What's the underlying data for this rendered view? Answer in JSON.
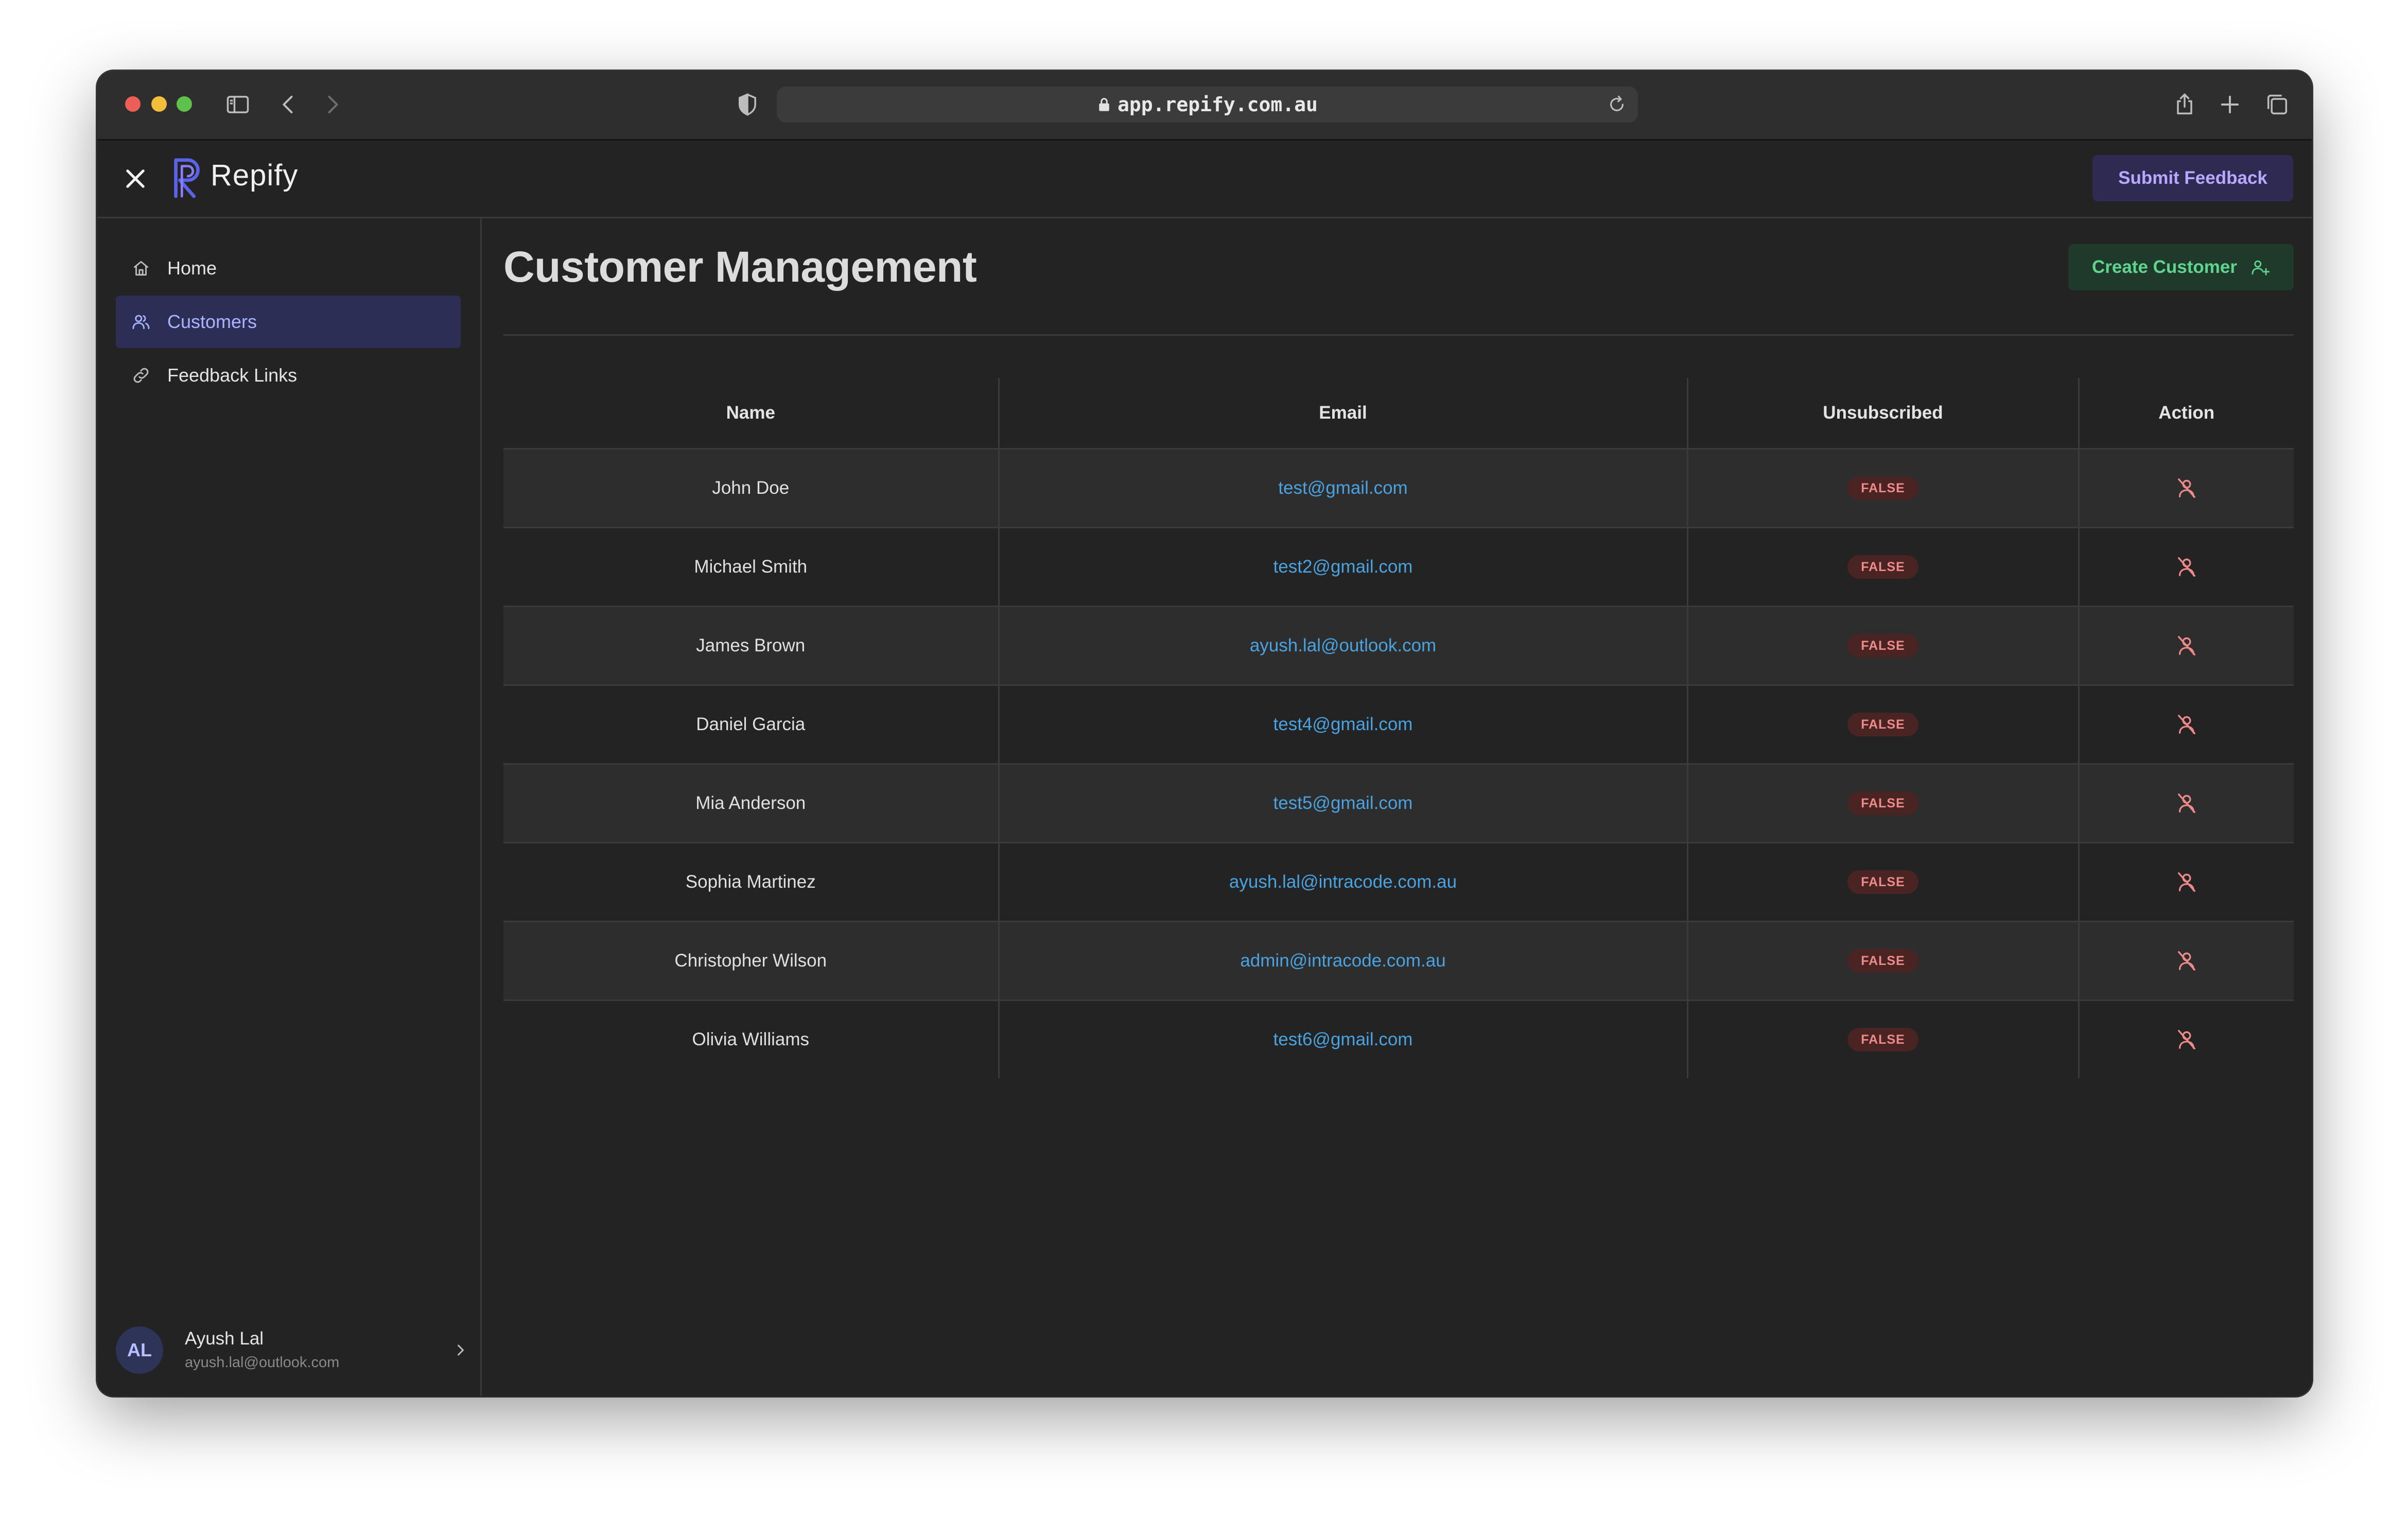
{
  "browser": {
    "url": "app.repify.com.au"
  },
  "app": {
    "logo_text": "Repify",
    "submit_feedback_label": "Submit Feedback"
  },
  "sidebar": {
    "items": [
      {
        "label": "Home",
        "icon": "home-icon"
      },
      {
        "label": "Customers",
        "icon": "users-icon",
        "active": true
      },
      {
        "label": "Feedback Links",
        "icon": "link-icon"
      }
    ],
    "user": {
      "initials": "AL",
      "name": "Ayush Lal",
      "email": "ayush.lal@outlook.com"
    }
  },
  "main": {
    "title": "Customer Management",
    "create_label": "Create Customer",
    "table": {
      "headers": [
        "Name",
        "Email",
        "Unsubscribed",
        "Action"
      ],
      "rows": [
        {
          "name": "John Doe",
          "email": "test@gmail.com",
          "unsubscribed": "FALSE"
        },
        {
          "name": "Michael Smith",
          "email": "test2@gmail.com",
          "unsubscribed": "FALSE"
        },
        {
          "name": "James Brown",
          "email": "ayush.lal@outlook.com",
          "unsubscribed": "FALSE"
        },
        {
          "name": "Daniel Garcia",
          "email": "test4@gmail.com",
          "unsubscribed": "FALSE"
        },
        {
          "name": "Mia Anderson",
          "email": "test5@gmail.com",
          "unsubscribed": "FALSE"
        },
        {
          "name": "Sophia Martinez",
          "email": "ayush.lal@intracode.com.au",
          "unsubscribed": "FALSE"
        },
        {
          "name": "Christopher Wilson",
          "email": "admin@intracode.com.au",
          "unsubscribed": "FALSE"
        },
        {
          "name": "Olivia Williams",
          "email": "test6@gmail.com",
          "unsubscribed": "FALSE"
        }
      ]
    }
  },
  "colors": {
    "accent": "#a9b4ff",
    "create_button": "#5fd48e",
    "badge_false": "#ef8a8a",
    "link": "#4aa3e0"
  }
}
